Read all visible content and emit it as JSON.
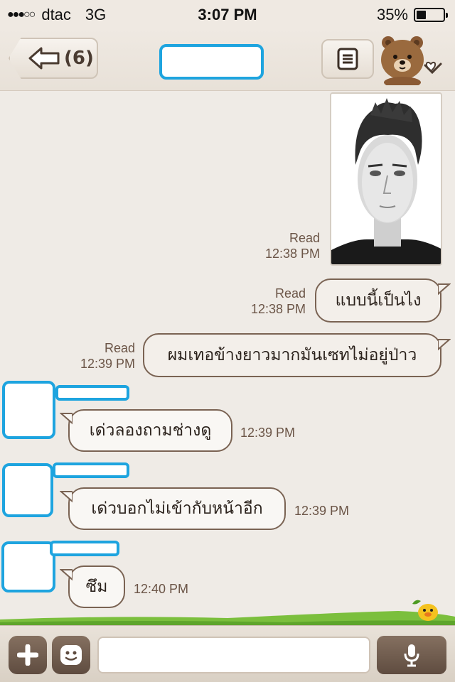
{
  "status_bar": {
    "signal": "●●●○○",
    "carrier": "dtac",
    "network": "3G",
    "time": "3:07 PM",
    "battery": "35%",
    "battery_level": 0.35
  },
  "header": {
    "back_count": "(6)"
  },
  "messages": [
    {
      "status": "Read",
      "time": "12:38 PM"
    },
    {
      "status": "Read",
      "time": "12:38 PM",
      "text": "แบบนี้เป็นไง"
    },
    {
      "status": "Read",
      "time": "12:39 PM",
      "text": "ผมเทอข้างยาวมากมันเซทไม่อยู่ป่าว"
    },
    {
      "time": "12:39 PM",
      "text": "เด่วลองถามช่างดู"
    },
    {
      "time": "12:39 PM",
      "text": "เด่วบอกไม่เข้ากับหน้าอีก"
    },
    {
      "time": "12:40 PM",
      "text": "ซึม"
    }
  ],
  "colors": {
    "background": "#efebe6",
    "bubble_border": "#7a6353",
    "redaction": "#1ea4df",
    "button_brown": "#6e5a4b"
  },
  "icons": [
    "back-arrow-icon",
    "menu-icon",
    "brown-bear-icon",
    "heart-chevron-icon",
    "plus-icon",
    "emoji-icon",
    "microphone-icon"
  ]
}
